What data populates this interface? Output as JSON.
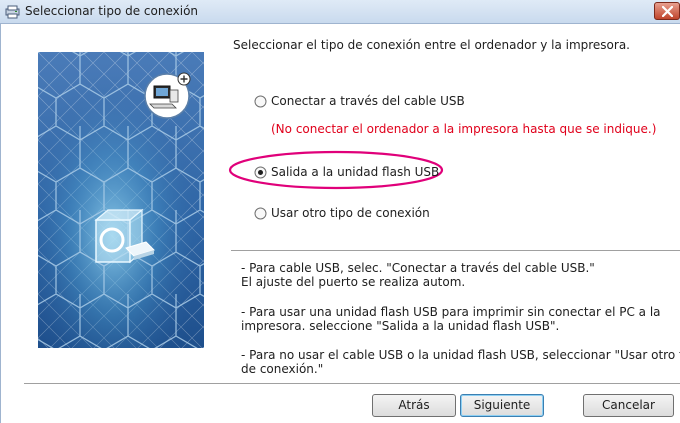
{
  "window": {
    "title": "Seleccionar tipo de conexión",
    "accent": "#c9daee",
    "close_color": "#c0452c"
  },
  "main": {
    "heading": "Seleccionar el tipo de conexión entre el ordenador y la impresora.",
    "options": [
      {
        "label": "Conectar a través del cable USB",
        "selected": false
      },
      {
        "label": "Salida a la unidad flash USB",
        "selected": true
      },
      {
        "label": "Usar otro tipo de conexión",
        "selected": false
      }
    ],
    "warning": "(No conectar el ordenador a la impresora hasta que se indique.)",
    "warning_color": "#e0001b",
    "highlight_color": "#e0007a",
    "help": [
      {
        "line1": "- Para cable USB, selec. \"Conectar a través del cable USB.\"",
        "line2": "El ajuste del puerto se realiza autom."
      },
      {
        "line1": "- Para usar una unidad flash USB para imprimir sin conectar el PC a la",
        "line2": "impresora. seleccione \"Salida a la unidad flash USB\"."
      },
      {
        "line1": "- Para no usar el cable USB o la unidad flash USB, seleccionar \"Usar otro tipo",
        "line2": "de conexión.\""
      }
    ]
  },
  "buttons": {
    "back": "Atrás",
    "next": "Siguiente",
    "cancel": "Cancelar"
  },
  "icons": {
    "app": "printer-app-icon",
    "close": "close-icon",
    "side_art": "hexagon-connection-illustration"
  }
}
